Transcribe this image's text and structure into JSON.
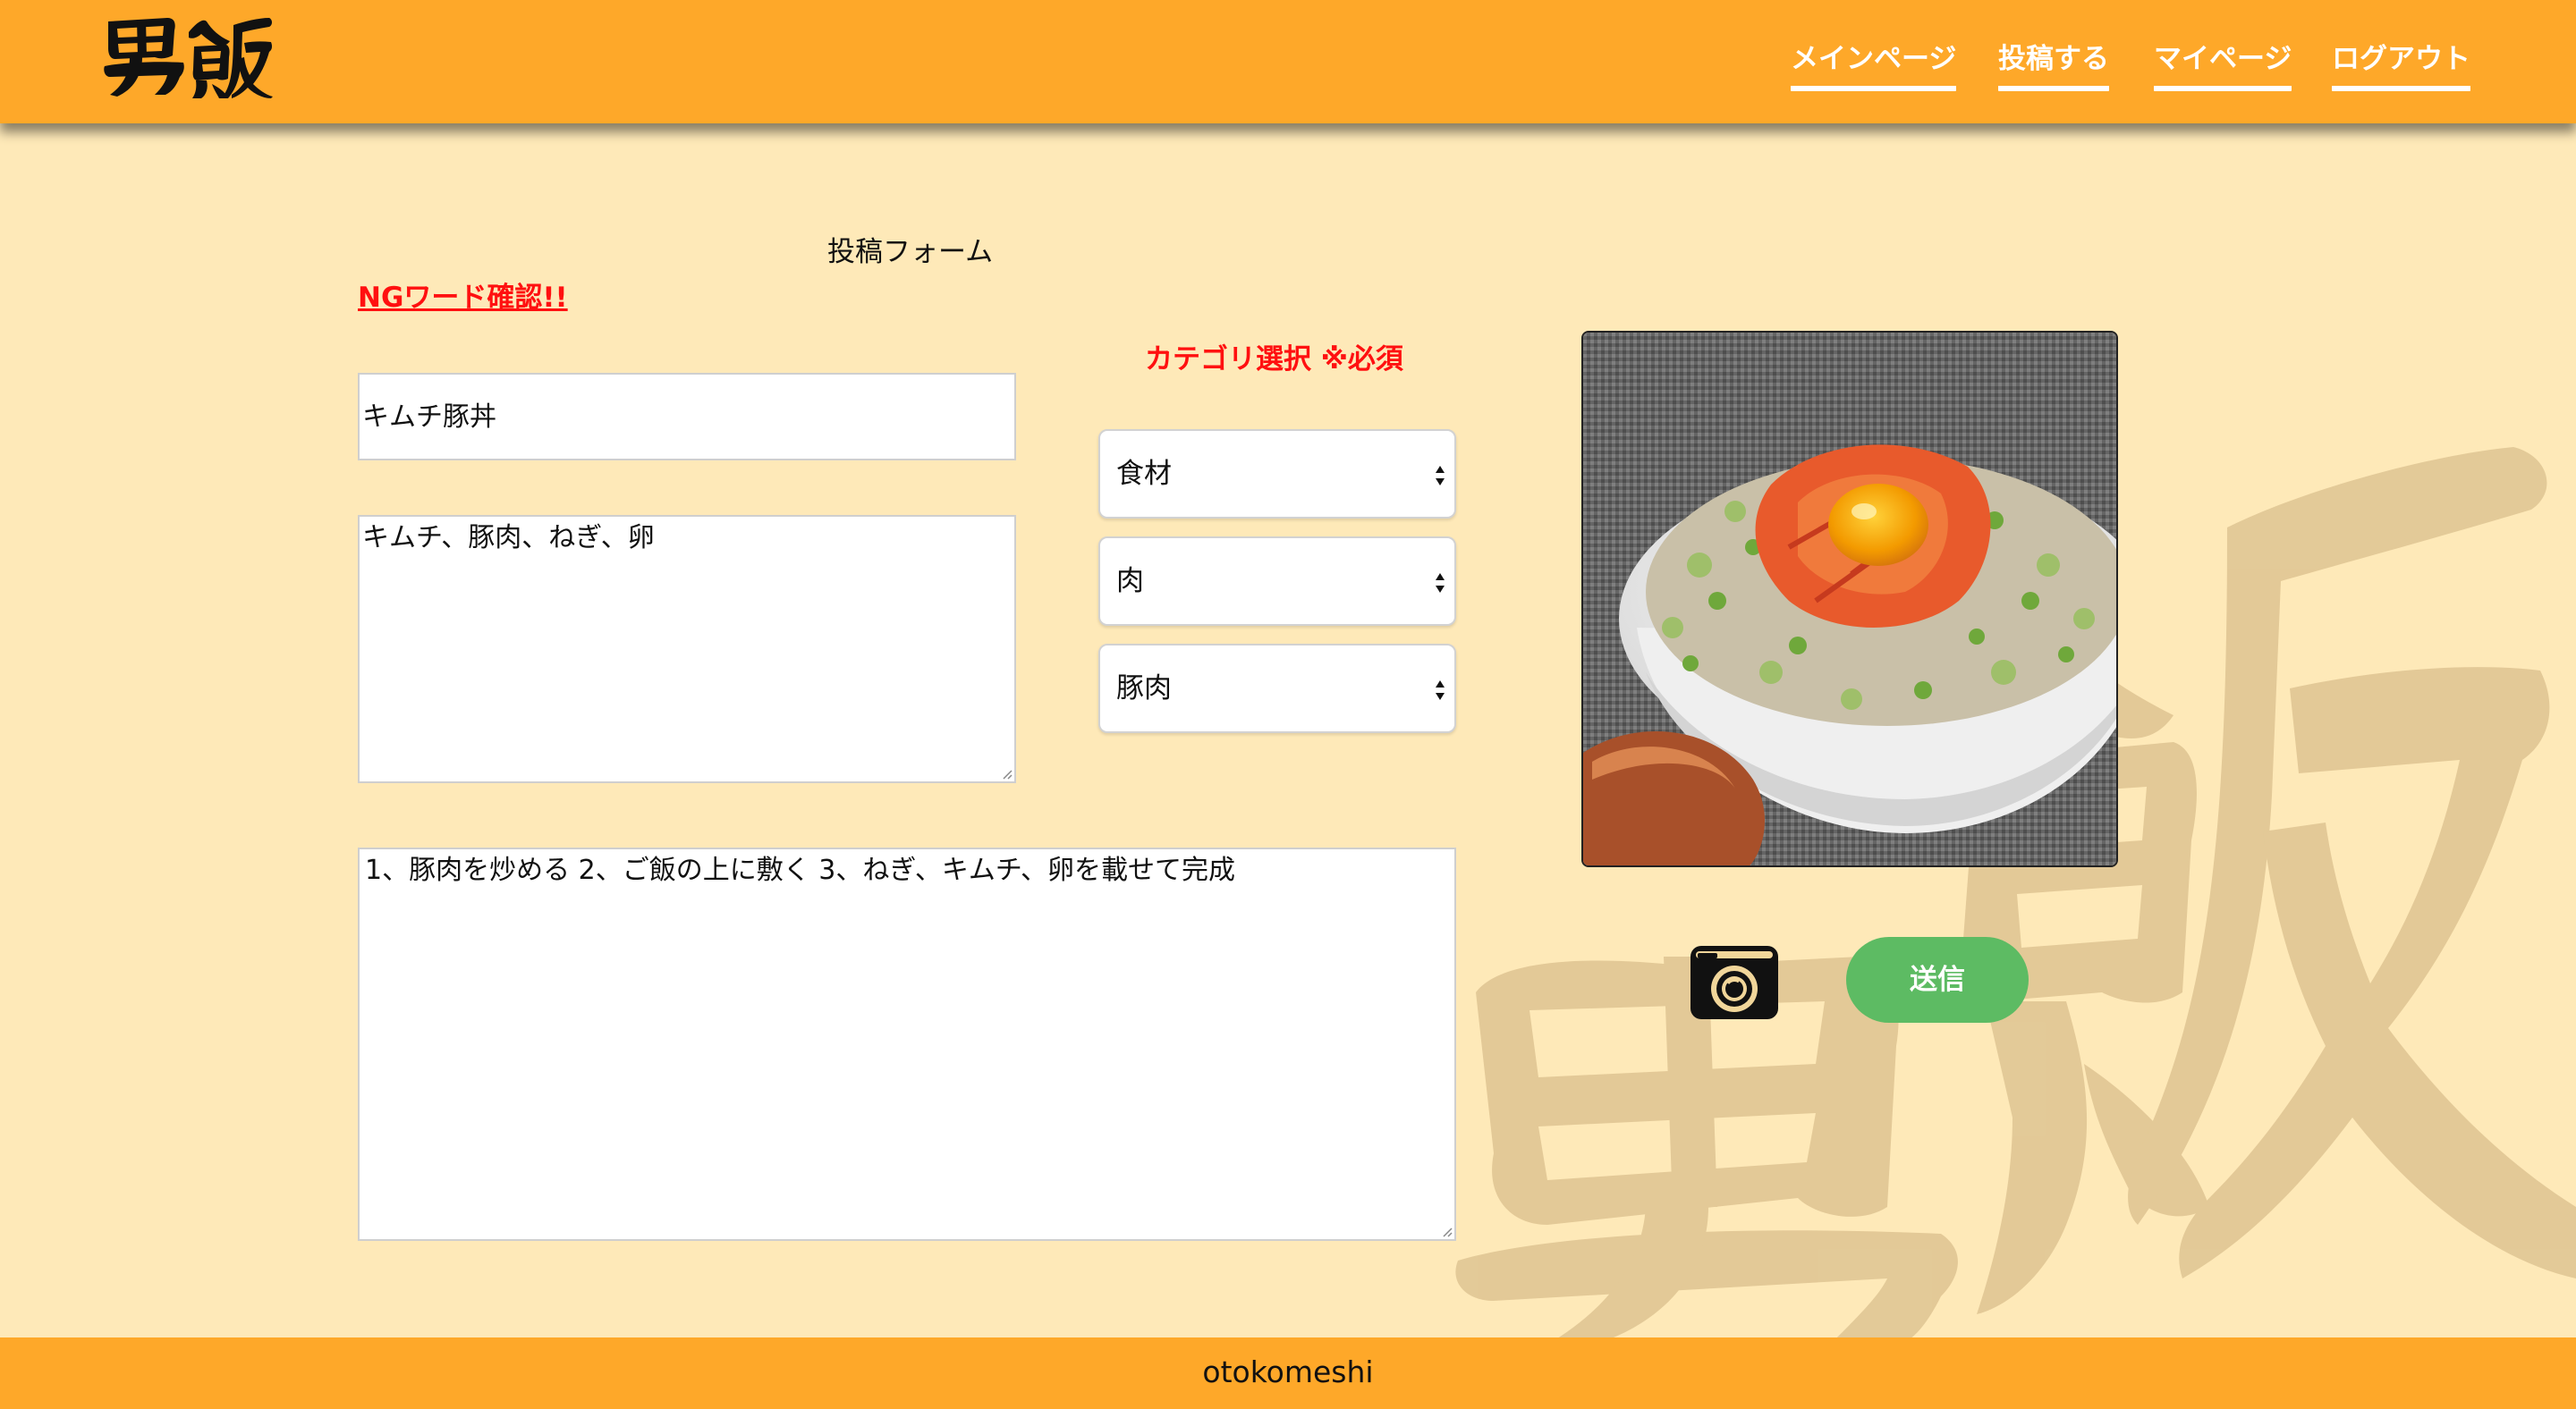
{
  "header": {
    "logo_text": "男飯",
    "nav": [
      {
        "label": "メインページ"
      },
      {
        "label": "投稿する"
      },
      {
        "label": "マイページ"
      },
      {
        "label": "ログアウト"
      }
    ]
  },
  "form": {
    "heading": "投稿フォーム",
    "ng_check_link": "NGワード確認!!",
    "title_value": "キムチ豚丼",
    "ingredients_value": "キムチ、豚肉、ねぎ、卵",
    "steps_value": "1、豚肉を炒める 2、ご飯の上に敷く 3、ねぎ、キムチ、卵を載せて完成",
    "category_heading": "カテゴリ選択 ※必須",
    "category_selects": [
      {
        "value": "食材"
      },
      {
        "value": "肉"
      },
      {
        "value": "豚肉"
      }
    ],
    "image_icon": "food-photo",
    "camera_icon": "camera-icon",
    "submit_label": "送信"
  },
  "background": {
    "watermark_text": "男飯"
  },
  "footer": {
    "text": "otokomeshi"
  },
  "colors": {
    "header_bg": "#fea829",
    "page_bg": "#fee9b8",
    "alert_red": "#ff1010",
    "submit_green": "#5dbb63",
    "watermark": "#e5cb9a"
  }
}
